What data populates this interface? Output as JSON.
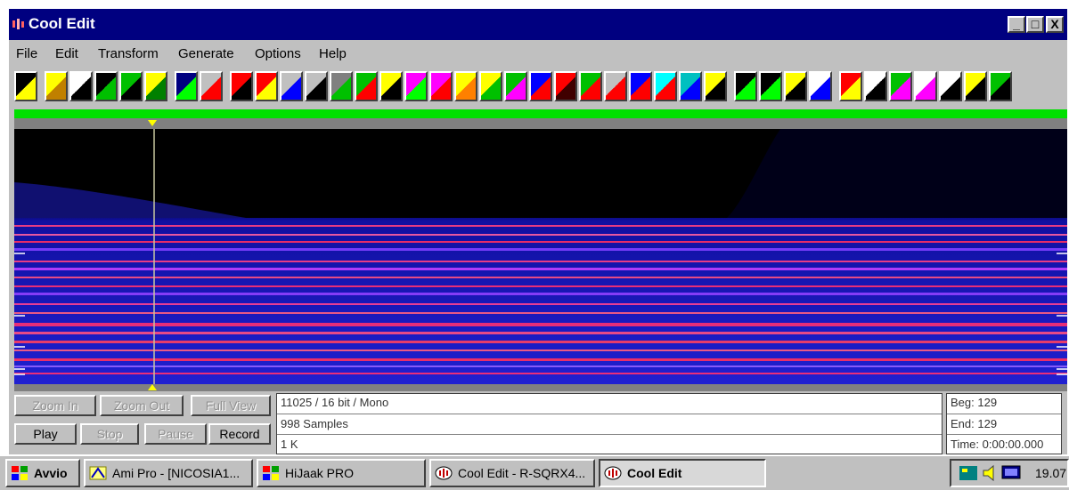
{
  "window": {
    "title": "Cool Edit"
  },
  "title_buttons": [
    "_",
    "□",
    "X"
  ],
  "menu": [
    "File",
    "Edit",
    "Transform",
    "Generate",
    "Options",
    "Help"
  ],
  "toolbar_icons": [
    {
      "name": "new-file-icon",
      "colors": [
        "#000",
        "#ffff00"
      ]
    },
    {
      "name": "open-file-icon",
      "colors": [
        "#ffff00",
        "#c08000"
      ]
    },
    {
      "name": "save-icon",
      "colors": [
        "#fff",
        "#000"
      ]
    },
    {
      "name": "select-view-icon",
      "colors": [
        "#000",
        "#00c000"
      ]
    },
    {
      "name": "select-entire-icon",
      "colors": [
        "#00c000",
        "#000"
      ]
    },
    {
      "name": "edit-pencil-icon",
      "colors": [
        "#ffff00",
        "#008000"
      ]
    },
    {
      "name": "zoom-icon",
      "colors": [
        "#000080",
        "#00ff00"
      ]
    },
    {
      "name": "rewind-icon",
      "colors": [
        "#c0c0c0",
        "#ff0000"
      ]
    },
    {
      "name": "stop-bar-icon",
      "colors": [
        "#ff0000",
        "#000"
      ]
    },
    {
      "name": "reverse-icon",
      "colors": [
        "#ff0000",
        "#ffff00"
      ]
    },
    {
      "name": "music-note-icon",
      "colors": [
        "#c0c0c0",
        "#0000ff"
      ]
    },
    {
      "name": "record-dot-icon",
      "colors": [
        "#c0c0c0",
        "#000"
      ]
    },
    {
      "name": "noise-icon",
      "colors": [
        "#808080",
        "#00c000"
      ]
    },
    {
      "name": "amplify-icon",
      "colors": [
        "#00c000",
        "#ff0000"
      ]
    },
    {
      "name": "stopwatch-icon",
      "colors": [
        "#ffff00",
        "#000"
      ]
    },
    {
      "name": "spectrum-icon",
      "colors": [
        "#ff00ff",
        "#00ff00"
      ]
    },
    {
      "name": "broadcast-icon",
      "colors": [
        "#ff00ff",
        "#ff0000"
      ]
    },
    {
      "name": "filter-icon",
      "colors": [
        "#ffff00",
        "#ff8000"
      ]
    },
    {
      "name": "envelope-icon",
      "colors": [
        "#ffff00",
        "#00c000"
      ]
    },
    {
      "name": "waves-icon",
      "colors": [
        "#00c000",
        "#ff00ff"
      ]
    },
    {
      "name": "flanger-icon",
      "colors": [
        "#0000ff",
        "#ff0000"
      ]
    },
    {
      "name": "distortion-icon",
      "colors": [
        "#ff0000",
        "#400000"
      ]
    },
    {
      "name": "graphic-eq-icon",
      "colors": [
        "#00c000",
        "#ff0000"
      ]
    },
    {
      "name": "bars-icon",
      "colors": [
        "#c0c0c0",
        "#ff0000"
      ]
    },
    {
      "name": "delay-icon",
      "colors": [
        "#0000ff",
        "#ff0000"
      ]
    },
    {
      "name": "pitch-icon",
      "colors": [
        "#00ffff",
        "#ff0000"
      ]
    },
    {
      "name": "mountain-icon",
      "colors": [
        "#00c0c0",
        "#0000ff"
      ]
    },
    {
      "name": "mix-1-icon",
      "colors": [
        "#ffff00",
        "#000"
      ]
    },
    {
      "name": "mix-2-icon",
      "colors": [
        "#000",
        "#00ff00"
      ]
    },
    {
      "name": "mix-3-icon",
      "colors": [
        "#000",
        "#00ff00"
      ]
    },
    {
      "name": "mix-4-icon",
      "colors": [
        "#ffff00",
        "#000"
      ]
    },
    {
      "name": "loop-icon",
      "colors": [
        "#fff",
        "#0000ff"
      ]
    },
    {
      "name": "stack-icon",
      "colors": [
        "#ff0000",
        "#ffff00"
      ]
    },
    {
      "name": "text-icon",
      "colors": [
        "#fff",
        "#000"
      ]
    },
    {
      "name": "scatter-icon",
      "colors": [
        "#00c000",
        "#ff00ff"
      ]
    },
    {
      "name": "marker-icon",
      "colors": [
        "#fff",
        "#ff00ff"
      ]
    },
    {
      "name": "notes-icon",
      "colors": [
        "#fff",
        "#000"
      ]
    },
    {
      "name": "help-icon",
      "colors": [
        "#ffff00",
        "#000"
      ]
    },
    {
      "name": "globe-icon",
      "colors": [
        "#00c000",
        "#000"
      ]
    }
  ],
  "controls": {
    "zoom_in": "Zoom In",
    "zoom_out": "Zoom Out",
    "full_view": "Full View",
    "play": "Play",
    "stop": "Stop",
    "pause": "Pause",
    "record": "Record"
  },
  "info": {
    "format": "11025 / 16 bit / Mono",
    "samples": "998 Samples",
    "size": "1 K"
  },
  "selection": {
    "beg": "Beg: 129",
    "end": "End: 129",
    "time": "Time: 0:00:00.000"
  },
  "taskbar": {
    "start": "Avvio",
    "tasks": [
      "Ami Pro - [NICOSIA1...",
      "HiJaak PRO",
      "Cool Edit - R-SQRX4...",
      "Cool Edit"
    ],
    "clock": "19.07"
  },
  "colors": {
    "title_bg": "#000080",
    "face": "#c0c0c0",
    "progress": "#00e000"
  }
}
